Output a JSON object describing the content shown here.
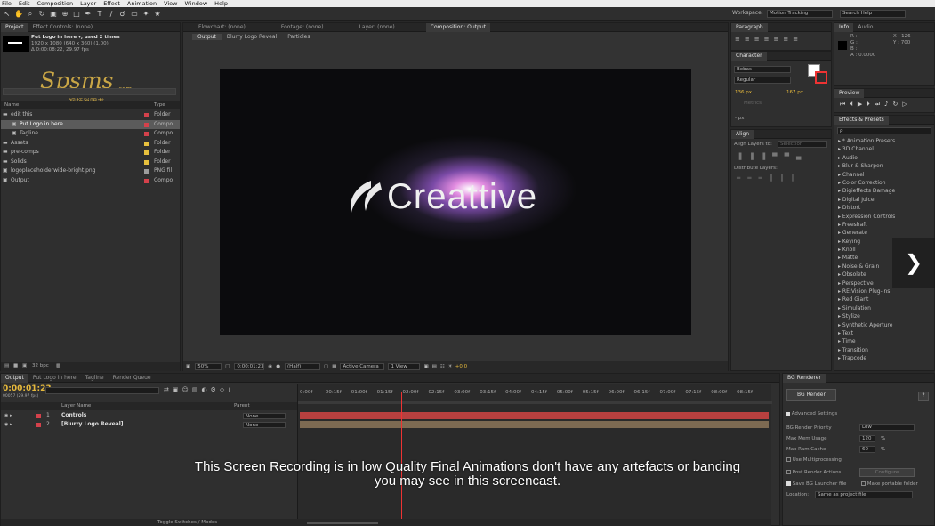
{
  "menu": [
    "File",
    "Edit",
    "Composition",
    "Layer",
    "Effect",
    "Animation",
    "View",
    "Window",
    "Help"
  ],
  "workspace": {
    "label": "Workspace:",
    "value": "Motion Tracking",
    "search_placeholder": "Search Help"
  },
  "project": {
    "tab": "Project",
    "effect_controls_tab": "Effect Controls: (none)",
    "footage_name": "Put Logo in here ▾, used 2 times",
    "footage_size": "1920 x 1080 (640 x 360) (1.00)",
    "footage_duration": "Δ 0:00:08:22, 29.97 fps",
    "col_name": "Name",
    "col_type": "Type",
    "items": [
      {
        "name": "edit this",
        "type": "Folder",
        "color": "#d4414b"
      },
      {
        "name": "Put Logo in here",
        "type": "Compo",
        "color": "#d4414b"
      },
      {
        "name": "Tagline",
        "type": "Compo",
        "color": "#d4414b"
      },
      {
        "name": "Assets",
        "type": "Folder",
        "color": "#e7c03d"
      },
      {
        "name": "pre-comps",
        "type": "Folder",
        "color": "#e7c03d"
      },
      {
        "name": "Solids",
        "type": "Folder",
        "color": "#e7c03d"
      },
      {
        "name": "logoplaceholderwide-bright.png",
        "type": "PNG fil",
        "color": "#9c9c9c"
      },
      {
        "name": "Output",
        "type": "Compo",
        "color": "#d4414b"
      }
    ],
    "bpc": "32 bpc"
  },
  "watermark": {
    "text": "Spsms",
    "sub": "视频说明书",
    "domain": ".com"
  },
  "comp_tabs": [
    "Flowchart: (none)",
    "Footage: (none)",
    "Layer: (none)",
    "Composition: Output"
  ],
  "comp_breadcrumbs": [
    "Output",
    "Blurry Logo Reveal",
    "Particles"
  ],
  "viewer": {
    "logo_text": "Creattive",
    "zoom": "50%",
    "timecode": "0:00:01:23",
    "resolution": "(Half)",
    "camera": "Active Camera",
    "views": "1 View",
    "exposure": "+0.0"
  },
  "paragraph": {
    "tab": "Paragraph"
  },
  "info": {
    "tabs": [
      "Info",
      "Audio"
    ],
    "r": "R :",
    "g": "G :",
    "b": "B :",
    "a": "A : 0.0000",
    "x": "X : 126",
    "y": "Y : 700"
  },
  "character": {
    "tab": "Character",
    "font": "Bebas",
    "style": "Regular",
    "size": "136 px",
    "leading": "167 px",
    "tracking": "Metrics",
    "indent": "- px"
  },
  "preview": {
    "tab": "Preview"
  },
  "effects": {
    "tab": "Effects & Presets",
    "search_placeholder": "ρ",
    "items": [
      "* Animation Presets",
      "3D Channel",
      "Audio",
      "Blur & Sharpen",
      "Channel",
      "Color Correction",
      "Digieffects Damage",
      "Digital Juice",
      "Distort",
      "Expression Controls",
      "Freeshaft",
      "Generate",
      "Keying",
      "Knoll",
      "Matte",
      "Noise & Grain",
      "Obsolete",
      "Perspective",
      "RE:Vision Plug-ins",
      "Red Giant",
      "Simulation",
      "Stylize",
      "Synthetic Aperture",
      "Text",
      "Time",
      "Transition",
      "Trapcode"
    ]
  },
  "align": {
    "tab": "Align",
    "align_to_label": "Align Layers to:",
    "align_to_value": "Selection",
    "distribute_label": "Distribute Layers:"
  },
  "timeline": {
    "tabs": [
      "Output",
      "Put Logo in here",
      "Tagline",
      "Render Queue"
    ],
    "timecode": "0:00:01:23",
    "frame": "00057 (29.97 fps)",
    "col_layer_name": "Layer Name",
    "col_parent": "Parent",
    "layers": [
      {
        "num": "1",
        "name": "Controls",
        "parent": "None",
        "color": "#d4414b"
      },
      {
        "num": "2",
        "name": "[Blurry Logo Reveal]",
        "parent": "None",
        "color": "#d4414b"
      }
    ],
    "ruler": [
      "0:00f",
      "00:15f",
      "01:00f",
      "01:15f",
      "02:00f",
      "02:15f",
      "03:00f",
      "03:15f",
      "04:00f",
      "04:15f",
      "05:00f",
      "05:15f",
      "06:00f",
      "06:15f",
      "07:00f",
      "07:15f",
      "08:00f",
      "08:15f"
    ],
    "toggle": "Toggle Switches / Modes",
    "playhead_fraction": 0.2175
  },
  "bg_render": {
    "tab": "BG Renderer",
    "button": "BG Render",
    "help": "?",
    "advanced": "Advanced Settings",
    "priority_label": "BG Render Priority",
    "priority_value": "Low",
    "mem_label": "Max Mem Usage",
    "mem_value": "120",
    "cache_label": "Max Ram Cache",
    "cache_value": "60",
    "pct": "%",
    "multi": "Use Multiprocessing",
    "post": "Post Render Actions",
    "configure": "Configure",
    "save_launcher": "Save BG Launcher file",
    "portable": "Make portable folder",
    "location_label": "Location:",
    "location_value": "Same as project file"
  },
  "caption": {
    "line1": "This Screen Recording is in low Quality Final Animations don't have any artefacts or banding",
    "line2": "you may see in this screencast."
  }
}
